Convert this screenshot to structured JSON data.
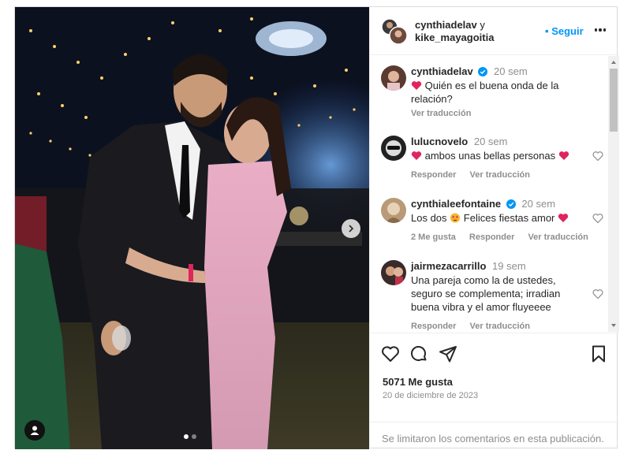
{
  "header": {
    "user1": "cynthiadelav",
    "connector": "y",
    "user2": "kike_mayagoitia",
    "follow_label": "Seguir",
    "follow_separator": "•"
  },
  "comments": [
    {
      "username": "cynthiadelav",
      "verified": true,
      "time": "20 sem",
      "text_lines": [
        "Quién es el buena onda de la",
        "relación?"
      ],
      "emoji_before": "red-heart",
      "actions": [
        "Ver traducción"
      ],
      "like_button": false
    },
    {
      "username": "lulucnovelo",
      "verified": false,
      "time": "20 sem",
      "text_lines": [
        "ambos unas bellas personas"
      ],
      "emoji_before": "red-heart",
      "emoji_after": "red-heart",
      "actions": [
        "Responder",
        "Ver traducción"
      ],
      "like_button": true
    },
    {
      "username": "cynthialeefontaine",
      "verified": true,
      "time": "20 sem",
      "text_lines": [
        "Los dos",
        "Felices fiestas amor"
      ],
      "emoji_mid": "star-struck-face",
      "emoji_after": "red-heart",
      "actions": [
        "2 Me gusta",
        "Responder",
        "Ver traducción"
      ],
      "like_button": true
    },
    {
      "username": "jairmezacarrillo",
      "verified": false,
      "time": "19 sem",
      "text_lines": [
        "Una pareja como la de ustedes,",
        "seguro se complementa; irradian",
        "buena vibra y el amor fluyeeee"
      ],
      "actions": [
        "Responder",
        "Ver traducción"
      ],
      "like_button": true
    }
  ],
  "footer": {
    "likes": "5071 Me gusta",
    "date": "20 de diciembre de 2023",
    "comments_limited": "Se limitaron los comentarios en esta publicación."
  },
  "carousel": {
    "slides": 2,
    "active_slide": 1
  },
  "colors": {
    "accent": "#0095f6",
    "secondary_text": "#8e8e8e",
    "heart": "#e0245e"
  }
}
